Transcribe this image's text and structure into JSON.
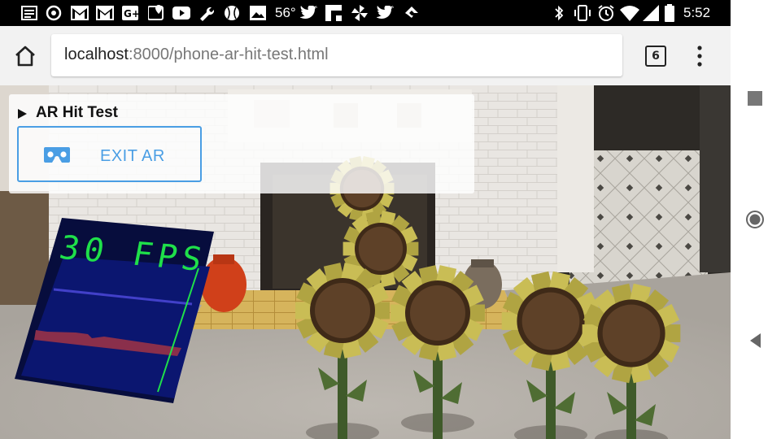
{
  "status_bar": {
    "temperature": "56°",
    "time": "5:52",
    "left_icons": [
      "newspaper-icon",
      "threads-icon",
      "gmail-icon",
      "gmail-icon",
      "google-plus-icon",
      "maps-icon",
      "youtube-icon",
      "wrench-icon",
      "baseball-icon",
      "photos-icon",
      "weather-icon",
      "twitter-icon",
      "flipboard-icon",
      "pinwheel-icon",
      "twitter-icon",
      "feedly-icon"
    ],
    "right_icons": [
      "bluetooth-icon",
      "vibrate-icon",
      "alarm-icon",
      "wifi-icon",
      "signal-icon",
      "battery-icon"
    ]
  },
  "toolbar": {
    "url_host": "localhost",
    "url_rest": ":8000/phone-ar-hit-test.html",
    "tab_count": "6"
  },
  "ar_panel": {
    "title": "AR Hit Test",
    "exit_label": "EXIT AR"
  },
  "fps_meter": {
    "label": "30 FPS"
  },
  "colors": {
    "accent": "#4a9ee4",
    "fps_text": "#1fe04a",
    "fps_bg": "#0b1670"
  }
}
